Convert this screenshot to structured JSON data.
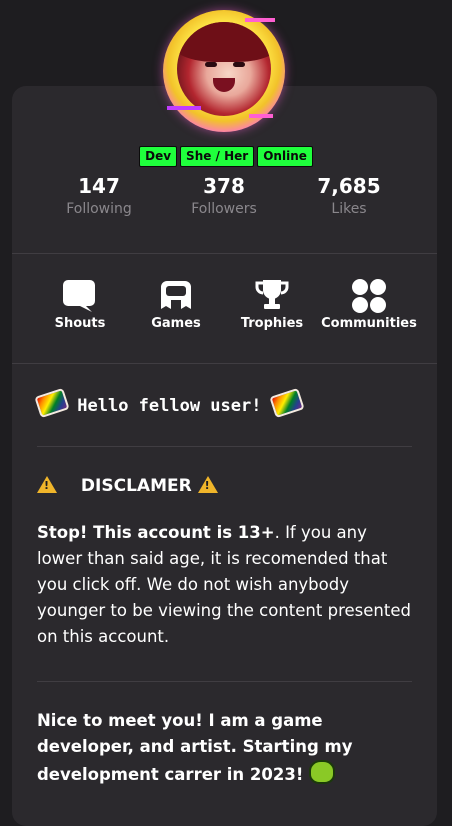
{
  "tags": [
    "Dev",
    "She / Her",
    "Online"
  ],
  "stats": [
    {
      "value": "147",
      "label": "Following"
    },
    {
      "value": "378",
      "label": "Followers"
    },
    {
      "value": "7,685",
      "label": "Likes"
    }
  ],
  "nav": [
    {
      "label": "Shouts",
      "icon": "speech-bubble-icon"
    },
    {
      "label": "Games",
      "icon": "gamepad-icon"
    },
    {
      "label": "Trophies",
      "icon": "trophy-icon"
    },
    {
      "label": "Communities",
      "icon": "communities-icon"
    }
  ],
  "bio": {
    "greeting": "Hello fellow user!",
    "disclaimer_title": "DISCLAMER",
    "disclaimer_bold": "Stop! This account is 13+",
    "disclaimer_rest": ". If you any lower than said age, it is recomended that you click off. We do not wish anybody younger to be viewing the content presented on this account.",
    "intro": "Nice to meet you! I am a game developer, and artist. Starting my development carrer in 2023!"
  },
  "colors": {
    "tag_bg": "#1fff3c",
    "card_bg": "#2b292d",
    "page_bg": "#1e1d20",
    "muted": "#8a878c",
    "warning": "#f0b52a"
  }
}
